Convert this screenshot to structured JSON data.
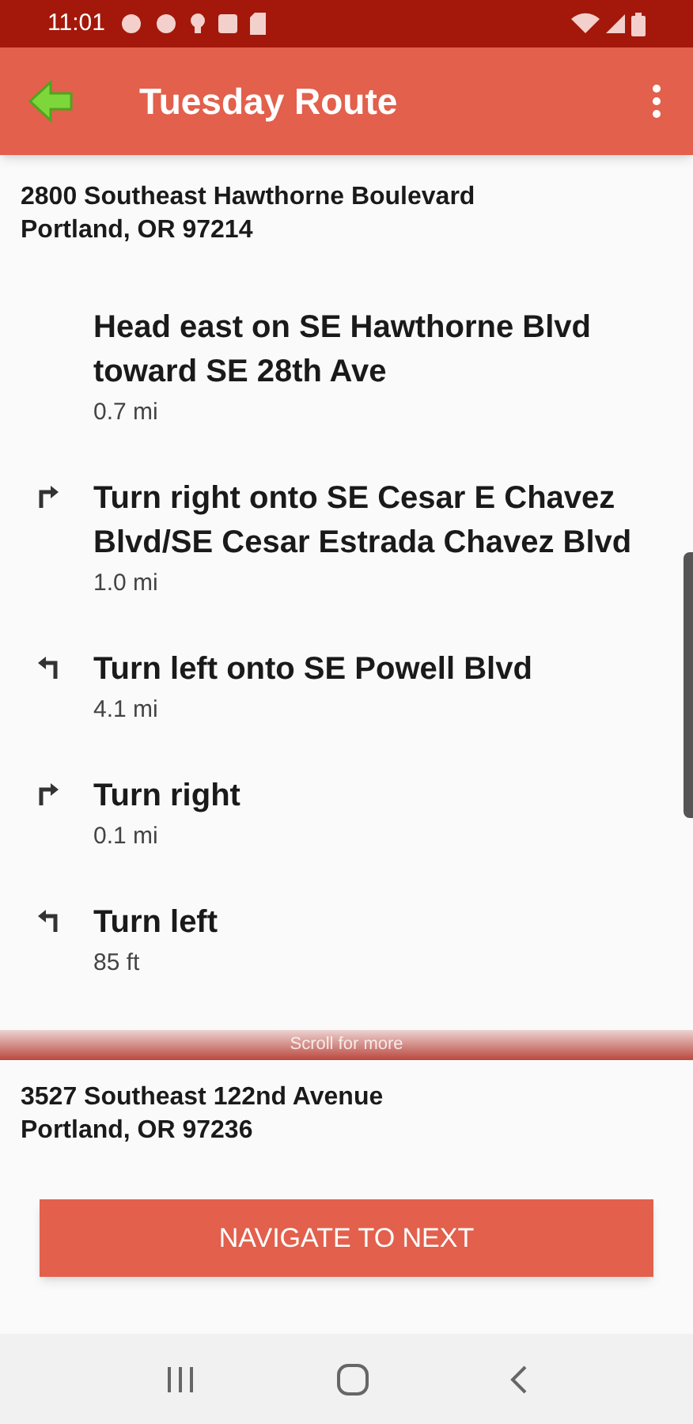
{
  "status_bar": {
    "time": "11:01"
  },
  "app_bar": {
    "title": "Tuesday Route"
  },
  "start_address": {
    "line_1": "2800 Southeast Hawthorne Boulevard",
    "line_2": "Portland, OR 97214"
  },
  "steps": [
    {
      "kind": "straight",
      "instruction": "Head east on SE Hawthorne Blvd toward SE 28th Ave",
      "distance": "0.7 mi"
    },
    {
      "kind": "right",
      "instruction": "Turn right onto SE Cesar E Chavez Blvd/SE Cesar Estrada Chavez Blvd",
      "distance": "1.0 mi"
    },
    {
      "kind": "left",
      "instruction": "Turn left onto SE Powell Blvd",
      "distance": "4.1 mi"
    },
    {
      "kind": "right",
      "instruction": "Turn right",
      "distance": "0.1 mi"
    },
    {
      "kind": "left",
      "instruction": "Turn left",
      "distance": "85 ft"
    }
  ],
  "scroll_hint": "Scroll for more",
  "end_address": {
    "line_1": "3527 Southeast 122nd Avenue",
    "line_2": "Portland, OR 97236"
  },
  "navigate_button": "NAVIGATE TO NEXT"
}
